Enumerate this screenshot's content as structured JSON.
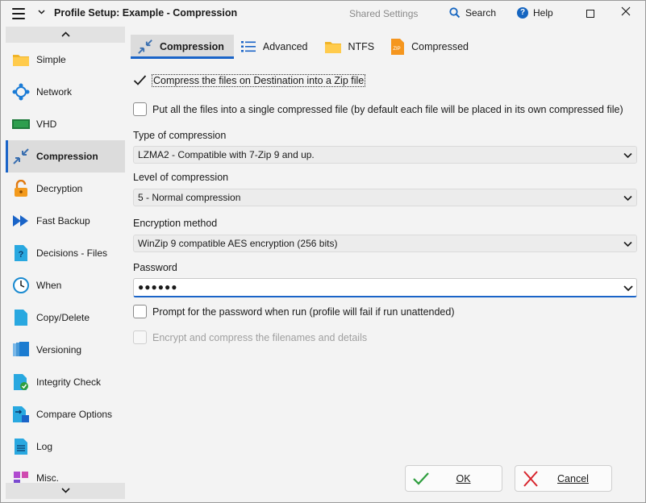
{
  "window": {
    "title": "Profile Setup: Example - Compression",
    "shared_settings": "Shared Settings",
    "search": "Search",
    "help": "Help"
  },
  "sidebar": {
    "items": [
      {
        "label": "Simple",
        "icon": "folder-icon"
      },
      {
        "label": "Network",
        "icon": "network-icon"
      },
      {
        "label": "VHD",
        "icon": "vhd-icon"
      },
      {
        "label": "Compression",
        "icon": "compression-icon",
        "active": true
      },
      {
        "label": "Decryption",
        "icon": "padlock-icon"
      },
      {
        "label": "Fast Backup",
        "icon": "fast-forward-icon"
      },
      {
        "label": "Decisions - Files",
        "icon": "question-file-icon"
      },
      {
        "label": "When",
        "icon": "clock-icon"
      },
      {
        "label": "Copy/Delete",
        "icon": "copy-icon"
      },
      {
        "label": "Versioning",
        "icon": "versions-icon"
      },
      {
        "label": "Integrity Check",
        "icon": "integrity-check-icon"
      },
      {
        "label": "Compare Options",
        "icon": "compare-icon"
      },
      {
        "label": "Log",
        "icon": "log-icon"
      },
      {
        "label": "Misc.",
        "icon": "misc-icon"
      }
    ]
  },
  "tabs": [
    {
      "label": "Compression",
      "active": true
    },
    {
      "label": "Advanced"
    },
    {
      "label": "NTFS"
    },
    {
      "label": "Compressed"
    }
  ],
  "form": {
    "compress_zip": {
      "label": "Compress the files on Destination into a Zip file",
      "checked": true
    },
    "single_file": {
      "label": "Put all the files into a single compressed file (by default each file will be placed in its own compressed file)",
      "checked": false
    },
    "type_label": "Type of compression",
    "type_value": "LZMA2 - Compatible with 7-Zip 9 and up.",
    "level_label": "Level of compression",
    "level_value": "5 - Normal compression",
    "encryption_label": "Encryption method",
    "encryption_value": "WinZip 9 compatible AES encryption (256 bits)",
    "password_label": "Password",
    "password_value": "●●●●●●",
    "prompt_password": {
      "label": "Prompt for the password when run (profile will fail if run unattended)",
      "checked": false
    },
    "encrypt_filenames": {
      "label": "Encrypt and compress the filenames and details",
      "checked": false,
      "disabled": true
    }
  },
  "buttons": {
    "ok": "OK",
    "cancel": "Cancel"
  },
  "colors": {
    "accent": "#1a64c8",
    "ok_green": "#2e9e3e",
    "cancel_red": "#d8242c"
  }
}
